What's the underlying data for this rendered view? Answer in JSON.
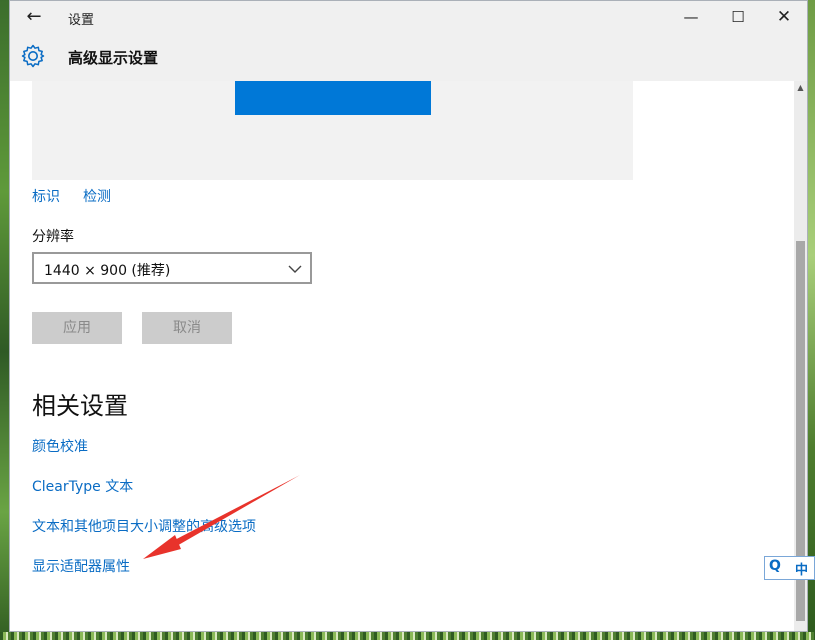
{
  "window": {
    "title": "设置",
    "page_title": "高级显示设置",
    "controls": {
      "minimize": "—",
      "maximize": "☐",
      "close": "✕"
    },
    "back_label": "←"
  },
  "display": {
    "identify_link": "标识",
    "detect_link": "检测",
    "resolution_label": "分辨率",
    "resolution_value": "1440 × 900 (推荐)",
    "apply_button": "应用",
    "cancel_button": "取消",
    "accent_color": "#0078d7"
  },
  "related": {
    "title": "相关设置",
    "links": [
      "颜色校准",
      "ClearType 文本",
      "文本和其他项目大小调整的高级选项",
      "显示适配器属性"
    ]
  },
  "ime": {
    "q": "Q",
    "lang": "中"
  },
  "icons": [
    "back-arrow-icon",
    "gear-icon",
    "chevron-down-icon",
    "annotation-arrow-icon"
  ]
}
